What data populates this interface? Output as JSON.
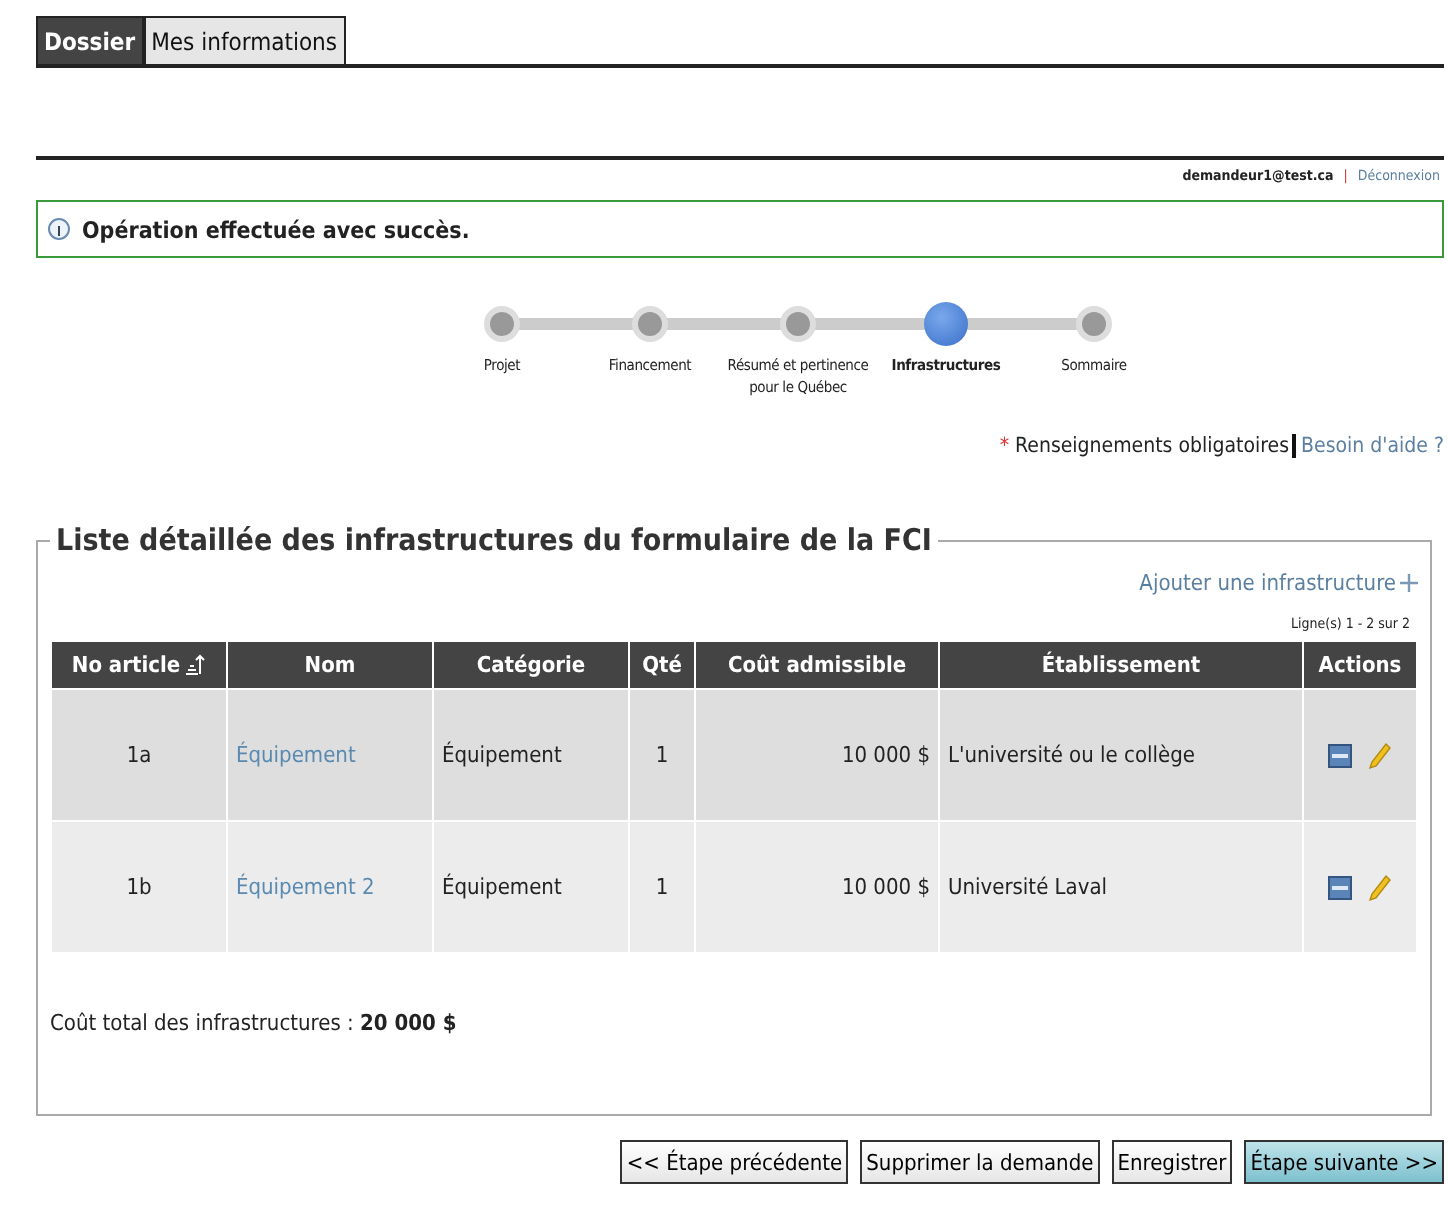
{
  "tabs": [
    {
      "label": "Dossier",
      "selected": true
    },
    {
      "label": "Mes informations",
      "selected": false
    }
  ],
  "user": {
    "email": "demandeur1@test.ca",
    "separator": "|",
    "logout": "Déconnexion"
  },
  "message": {
    "text": "Opération effectuée avec succès."
  },
  "steps": [
    {
      "label": "Projet",
      "selected": false
    },
    {
      "label": "Financement",
      "selected": false
    },
    {
      "label": "Résumé et pertinence pour le Québec",
      "selected": false
    },
    {
      "label": "Infrastructures",
      "selected": true
    },
    {
      "label": "Sommaire",
      "selected": false
    }
  ],
  "required": {
    "mark": "*",
    "text": "Renseignements obligatoires",
    "help": "Besoin d'aide ?"
  },
  "section": {
    "title": "Liste détaillée des infrastructures du formulaire de la FCI",
    "add_link": "Ajouter une infrastructure",
    "pager": "Ligne(s) 1 - 2 sur 2",
    "columns": [
      "No article",
      "Nom",
      "Catégorie",
      "Qté",
      "Coût admissible",
      "Établissement",
      "Actions"
    ],
    "rows": [
      {
        "number": "1a",
        "name": "Équipement",
        "category": "Équipement",
        "qty": "1",
        "cost": "10 000 $",
        "institution": "L'université ou le collège"
      },
      {
        "number": "1b",
        "name": "Équipement 2",
        "category": "Équipement",
        "qty": "1",
        "cost": "10 000 $",
        "institution": "Université Laval"
      }
    ],
    "total": "Coût total des infrastructures : **20 000 $**"
  },
  "buttons": [
    "<< Étape précédente",
    "Supprimer la demande",
    "Enregistrer",
    "Étape suivante >>"
  ]
}
